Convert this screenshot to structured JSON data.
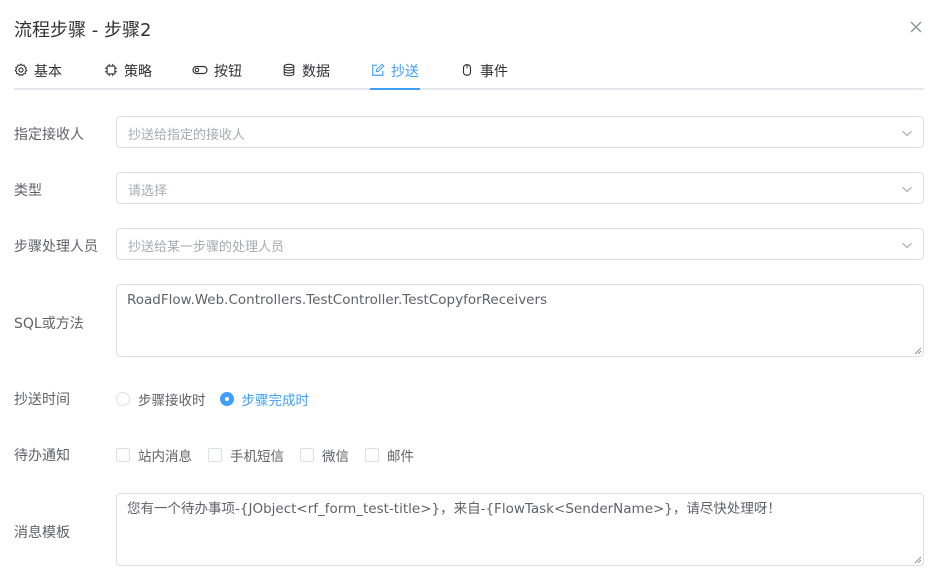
{
  "dialog": {
    "title": "流程步骤 - 步骤2",
    "close_icon": "close-icon"
  },
  "tabs": [
    {
      "label": "基本",
      "icon": "gear-icon"
    },
    {
      "label": "策略",
      "icon": "chip-icon"
    },
    {
      "label": "按钮",
      "icon": "toggle-icon"
    },
    {
      "label": "数据",
      "icon": "database-icon"
    },
    {
      "label": "抄送",
      "icon": "edit-icon",
      "active": true
    },
    {
      "label": "事件",
      "icon": "mouse-icon"
    }
  ],
  "accent_color": "#409eff",
  "form": {
    "receiver": {
      "label": "指定接收人",
      "placeholder": "抄送给指定的接收人"
    },
    "type": {
      "label": "类型",
      "placeholder": "请选择"
    },
    "step_handler": {
      "label": "步骤处理人员",
      "placeholder": "抄送给某一步骤的处理人员"
    },
    "sql": {
      "label": "SQL或方法",
      "value": "RoadFlow.Web.Controllers.TestController.TestCopyforReceivers"
    },
    "copy_time": {
      "label": "抄送时间",
      "options": [
        {
          "label": "步骤接收时",
          "checked": false
        },
        {
          "label": "步骤完成时",
          "checked": true
        }
      ]
    },
    "todo_notice": {
      "label": "待办通知",
      "options": [
        {
          "label": "站内消息",
          "checked": false
        },
        {
          "label": "手机短信",
          "checked": false
        },
        {
          "label": "微信",
          "checked": false
        },
        {
          "label": "邮件",
          "checked": false
        }
      ]
    },
    "message_template": {
      "label": "消息模板",
      "value": "您有一个待办事项-{JObject<rf_form_test-title>}，来自-{FlowTask<SenderName>}，请尽快处理呀！"
    }
  }
}
